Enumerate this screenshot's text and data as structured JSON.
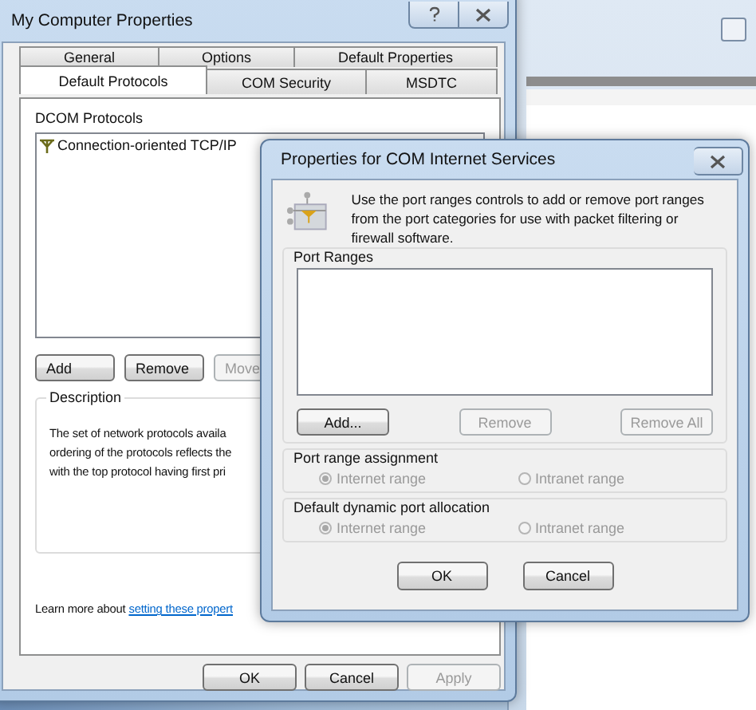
{
  "main_window": {
    "title": "My Computer Properties",
    "tab_rows": [
      [
        {
          "label": "General",
          "selected": false
        },
        {
          "label": "Options",
          "selected": false
        },
        {
          "label": "Default Properties",
          "selected": false
        }
      ],
      [
        {
          "label": "Default Protocols",
          "selected": true
        },
        {
          "label": "COM Security",
          "selected": false
        },
        {
          "label": "MSDTC",
          "selected": false
        }
      ]
    ],
    "protocols_label": "DCOM Protocols",
    "protocols": [
      {
        "name": "Connection-oriented TCP/IP"
      }
    ],
    "list_buttons": [
      {
        "label": "Add",
        "disabled": false
      },
      {
        "label": "Remove",
        "disabled": false
      },
      {
        "label": "Move",
        "disabled": true
      }
    ],
    "description": {
      "title": "Description",
      "lines": [
        "The set of network protocols availa",
        "ordering of the protocols reflects the",
        "with the top protocol having first pri"
      ]
    },
    "learn_more": {
      "text": "Learn more about",
      "link": "setting these propert"
    },
    "buttons": [
      {
        "label": "OK",
        "disabled": false
      },
      {
        "label": "Cancel",
        "disabled": false
      },
      {
        "label": "Apply",
        "disabled": true
      }
    ]
  },
  "dialog": {
    "title": "Properties for COM Internet Services",
    "intro": "Use the port ranges controls to add or remove port ranges from the port categories for use with packet filtering or firewall software.",
    "port_ranges": {
      "label": "Port Ranges",
      "buttons": [
        {
          "label": "Add...",
          "disabled": false
        },
        {
          "label": "Remove",
          "disabled": true
        },
        {
          "label": "Remove All",
          "disabled": true
        }
      ]
    },
    "groups": [
      {
        "label": "Port range assignment",
        "disabled": true,
        "options": [
          {
            "label": "Internet range",
            "selected": true
          },
          {
            "label": "Intranet range",
            "selected": false
          }
        ]
      },
      {
        "label": "Default dynamic port allocation",
        "disabled": true,
        "options": [
          {
            "label": "Internet range",
            "selected": true
          },
          {
            "label": "Intranet range",
            "selected": false
          }
        ]
      }
    ],
    "buttons": [
      {
        "label": "OK",
        "disabled": false
      },
      {
        "label": "Cancel",
        "disabled": false
      }
    ]
  }
}
